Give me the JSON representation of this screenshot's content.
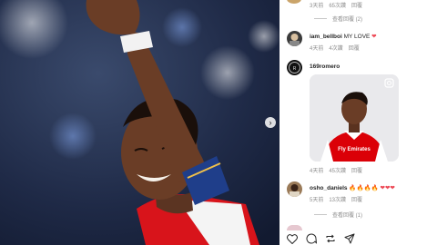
{
  "post": {
    "carousel_next_icon": "chevron-right-icon"
  },
  "comments": {
    "top_meta": {
      "time": "3天前",
      "likes": "65次讚",
      "reply": "回覆"
    },
    "top_view_replies": "查看回覆 (2)",
    "c1": {
      "username": "iam_bellboi",
      "text": "MY LOVE",
      "emoji": "❤",
      "time": "4天前",
      "likes": "4次讚",
      "reply": "回覆"
    },
    "c2": {
      "username": "169romero",
      "time": "4天前",
      "likes": "45次讚",
      "reply": "回覆"
    },
    "c3": {
      "username": "osho_daniels",
      "emojis": "🔥🔥🔥🔥 ❤❤❤",
      "time": "5天前",
      "likes": "13次讚",
      "reply": "回覆"
    },
    "c3_view_replies": "查看回覆 (1)"
  },
  "shared_image": {
    "kit_sponsor": "Fly Emirates",
    "corner_icon": "instagram-icon"
  },
  "actions": [
    "heart-icon",
    "comment-icon",
    "repost-icon",
    "share-icon"
  ],
  "colors": {
    "accent_red": "#ed4956",
    "arsenal_red": "#db0007",
    "muted_text": "#8e8e8e"
  }
}
